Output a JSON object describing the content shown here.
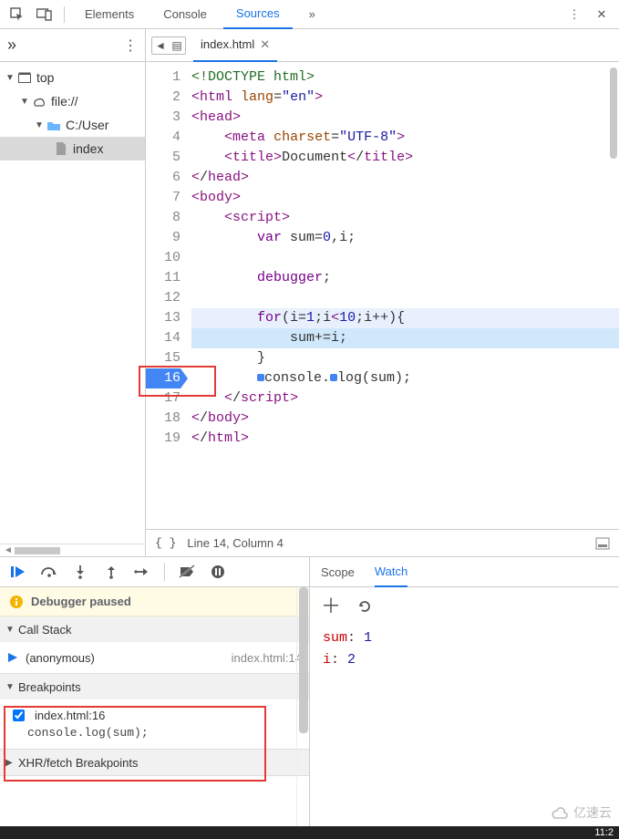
{
  "tabs": {
    "elements": "Elements",
    "console": "Console",
    "sources": "Sources",
    "more": "»"
  },
  "sidebar": {
    "more": "»",
    "top": "top",
    "file": "file://",
    "folder": "C:/User",
    "indexfile": "index"
  },
  "editor": {
    "filename": "index.html",
    "lines": [
      "<!DOCTYPE html>",
      "<html lang=\"en\">",
      "<head>",
      "    <meta charset=\"UTF-8\">",
      "    <title>Document</title>",
      "</head>",
      "<body>",
      "    <script>",
      "        var sum=0,i;",
      "",
      "        debugger;",
      "",
      "        for(i=1;i<10;i++){",
      "            sum+=i;",
      "        }",
      "        console.log(sum);",
      "    </script>",
      "</body>",
      "</html>"
    ],
    "breakpoint_line": 16,
    "status": {
      "format": "{ }",
      "pos": "Line 14, Column 4"
    }
  },
  "debugger": {
    "paused": "Debugger paused",
    "scope": "Scope",
    "watch": "Watch",
    "callstack_title": "Call Stack",
    "stack": [
      {
        "name": "(anonymous)",
        "loc": "index.html:14"
      }
    ],
    "breakpoints_title": "Breakpoints",
    "bp": {
      "label": "index.html:16",
      "code": "console.log(sum);",
      "checked": true
    },
    "xhr_title": "XHR/fetch Breakpoints"
  },
  "watchvars": [
    {
      "k": "sum",
      "v": "1"
    },
    {
      "k": "i",
      "v": "2"
    }
  ],
  "watermark": "亿速云",
  "taskbar_time": "11:2"
}
